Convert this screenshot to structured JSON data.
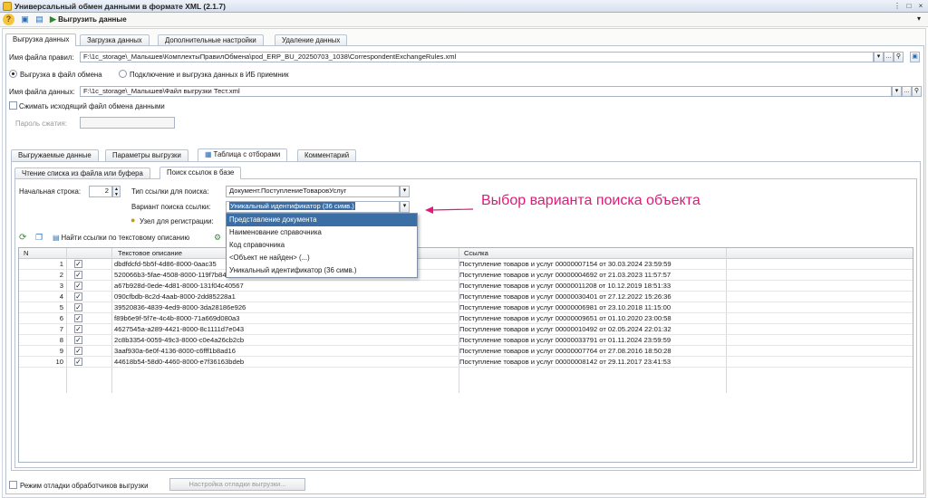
{
  "window": {
    "title": "Универсальный обмен данными в формате XML (2.1.7)",
    "controls": [
      "⋮",
      "□",
      "×"
    ]
  },
  "toolbar": {
    "unload_label": "Выгрузить данные"
  },
  "main_tabs": [
    "Выгрузка данных",
    "Загрузка данных",
    "Дополнительные настройки",
    "Удаление данных"
  ],
  "rules": {
    "label": "Имя файла правил:",
    "value": "F:\\1c_storage\\_Малышев\\КомплектыПравилОбмена\\pod_ERP_BU_20250703_1038\\CorrespondentExchangeRules.xml"
  },
  "mode": {
    "option1": "Выгрузка в файл обмена",
    "option2": "Подключение и выгрузка данных в ИБ приемник"
  },
  "datafile": {
    "label": "Имя файла данных:",
    "value": "F:\\1c_storage\\_Малышев\\Файл выгрузки Тест.xml"
  },
  "compress": {
    "label": "Сжимать исходящий файл обмена данными",
    "password_label": "Пароль сжатия:"
  },
  "sub_tabs": [
    "Выгружаемые данные",
    "Параметры выгрузки",
    "Таблица с отборами",
    "Комментарий"
  ],
  "inner_tabs": [
    "Чтение списка из файла или буфера",
    "Поиск ссылок в базе"
  ],
  "search": {
    "start_row_label": "Начальная строка:",
    "start_row_value": "2",
    "ref_type_label": "Тип ссылки для поиска:",
    "ref_type_value": "Документ.ПоступлениеТоваровУслуг",
    "variant_label": "Вариант поиска ссылки:",
    "variant_value": "Уникальный идентификатор (36 симв.)",
    "node_label": "Узел для регистрации:"
  },
  "dropdown": {
    "items": [
      "Представление документа",
      "Наименование справочника",
      "Код справочника",
      "<Объект не найден> (...)",
      "Уникальный идентификатор (36 симв.)"
    ]
  },
  "annotation": "Выбор варианта поиска объекта",
  "grid_toolbar": {
    "find_label": "Найти ссылки по текстовому описанию"
  },
  "grid": {
    "columns": [
      "N",
      "Текстовое описание",
      "Ссылка"
    ],
    "rows": [
      {
        "n": "1",
        "text": "dbdfdcfd-5b5f-4d86-8000-0aac35",
        "ref": "Поступление товаров и услуг 00000007154 от 30.03.2024 23:59:59"
      },
      {
        "n": "2",
        "text": "520066b3-5fae-4508-8000-119f7b8446e9",
        "ref": "Поступление товаров и услуг 00000004692 от 21.03.2023 11:57:57"
      },
      {
        "n": "3",
        "text": "a67b928d-0ede-4d81-8000-131f04c40567",
        "ref": "Поступление товаров и услуг 00000011208 от 10.12.2019 18:51:33"
      },
      {
        "n": "4",
        "text": "090cfbdb-8c2d-4aab-8000-2dd85228a1",
        "ref": "Поступление товаров и услуг 00000030401 от 27.12.2022 15:26:36"
      },
      {
        "n": "5",
        "text": "39520836-4839-4ed9-8000-3da28186e926",
        "ref": "Поступление товаров и услуг 00000006981 от 23.10.2018 11:15:00"
      },
      {
        "n": "6",
        "text": "f89b6e9f-5f7e-4c4b-8000-71a669d080a3",
        "ref": "Поступление товаров и услуг 00000009651 от 01.10.2020 23:00:58"
      },
      {
        "n": "7",
        "text": "4627545a-a289-4421-8000-8c1111d7e043",
        "ref": "Поступление товаров и услуг 00000010492 от 02.05.2024 22:01:32"
      },
      {
        "n": "8",
        "text": "2c8b3354-0059-49c3-8000-c0e4a26cb2cb",
        "ref": "Поступление товаров и услуг 00000033791 от 01.11.2024 23:59:59"
      },
      {
        "n": "9",
        "text": "3aaf930a-6e0f-4136-8000-c6fff1b8ad16",
        "ref": "Поступление товаров и услуг 00000007764 от 27.08.2016 18:50:28"
      },
      {
        "n": "10",
        "text": "44618b54-58d0-4460-8000-e7f36163bdeb",
        "ref": "Поступление товаров и услуг 00000008142 от 29.11.2017 23:41:53"
      }
    ]
  },
  "footer": {
    "debug_label": "Режим отладки обработчиков выгрузки",
    "debug_button": "Настройка отладки выгрузки..."
  }
}
